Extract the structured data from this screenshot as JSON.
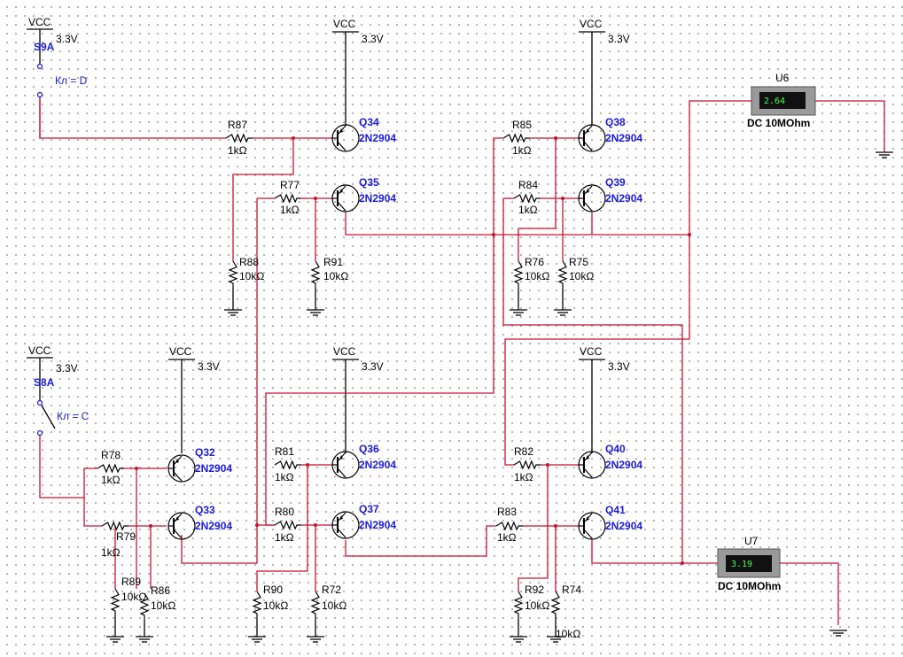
{
  "supplies": [
    {
      "id": "vcc1",
      "name": "VCC",
      "value": "3.3V"
    },
    {
      "id": "vcc2",
      "name": "VCC",
      "value": "3.3V"
    },
    {
      "id": "vcc3",
      "name": "VCC",
      "value": "3.3V"
    },
    {
      "id": "vcc4",
      "name": "VCC",
      "value": "3.3V"
    },
    {
      "id": "vcc5",
      "name": "VCC",
      "value": "3.3V"
    },
    {
      "id": "vcc6",
      "name": "VCC",
      "value": "3.3V"
    },
    {
      "id": "vcc7",
      "name": "VCC",
      "value": "3.3V"
    }
  ],
  "switches": [
    {
      "ref": "S9A",
      "key": "Кл = D"
    },
    {
      "ref": "S8A",
      "key": "Кл = C"
    }
  ],
  "transistors": [
    {
      "ref": "Q34",
      "model": "2N2904"
    },
    {
      "ref": "Q35",
      "model": "2N2904"
    },
    {
      "ref": "Q38",
      "model": "2N2904"
    },
    {
      "ref": "Q39",
      "model": "2N2904"
    },
    {
      "ref": "Q32",
      "model": "2N2904"
    },
    {
      "ref": "Q33",
      "model": "2N2904"
    },
    {
      "ref": "Q36",
      "model": "2N2904"
    },
    {
      "ref": "Q37",
      "model": "2N2904"
    },
    {
      "ref": "Q40",
      "model": "2N2904"
    },
    {
      "ref": "Q41",
      "model": "2N2904"
    }
  ],
  "resistors": [
    {
      "ref": "R87",
      "value": "1kΩ"
    },
    {
      "ref": "R77",
      "value": "1kΩ"
    },
    {
      "ref": "R88",
      "value": "10kΩ"
    },
    {
      "ref": "R91",
      "value": "10kΩ"
    },
    {
      "ref": "R85",
      "value": "1kΩ"
    },
    {
      "ref": "R84",
      "value": "1kΩ"
    },
    {
      "ref": "R76",
      "value": "10kΩ"
    },
    {
      "ref": "R75",
      "value": "10kΩ"
    },
    {
      "ref": "R78",
      "value": "1kΩ"
    },
    {
      "ref": "R79",
      "value": "1kΩ"
    },
    {
      "ref": "R89",
      "value": "10kΩ"
    },
    {
      "ref": "R86",
      "value": "10kΩ"
    },
    {
      "ref": "R81",
      "value": "1kΩ"
    },
    {
      "ref": "R80",
      "value": "1kΩ"
    },
    {
      "ref": "R90",
      "value": "10kΩ"
    },
    {
      "ref": "R72",
      "value": "10kΩ"
    },
    {
      "ref": "R82",
      "value": "1kΩ"
    },
    {
      "ref": "R83",
      "value": "1kΩ"
    },
    {
      "ref": "R92",
      "value": "10kΩ"
    },
    {
      "ref": "R74",
      "value": "10kΩ"
    }
  ],
  "voltmeters": [
    {
      "ref": "U6",
      "reading": "2.64",
      "mode": "DC  10MOhm"
    },
    {
      "ref": "U7",
      "reading": "3.19",
      "mode": "DC  10MOhm"
    }
  ]
}
